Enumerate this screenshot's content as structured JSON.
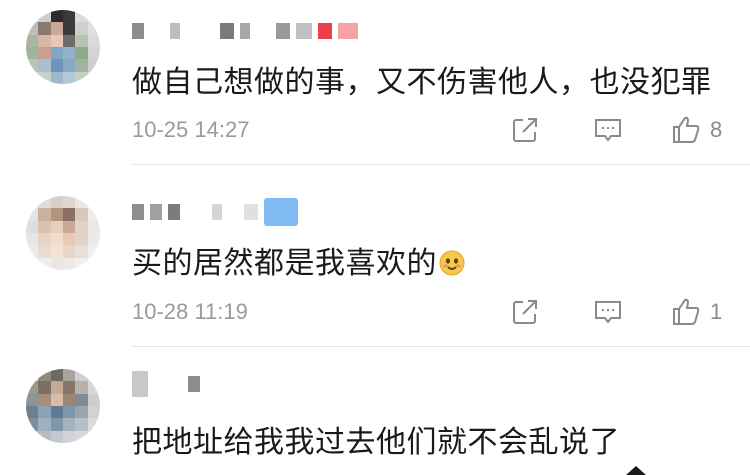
{
  "comments": [
    {
      "text": "做自己想做的事，又不伤害他人，也没犯罪",
      "timestamp": "10-25 14:27",
      "likes": "8",
      "emoji": ""
    },
    {
      "text": "买的居然都是我喜欢的",
      "timestamp": "10-28 11:19",
      "likes": "1",
      "emoji": "smiling-face-emoji"
    },
    {
      "text": "把地址给我我过去他们就不会乱说了",
      "timestamp": "",
      "likes": "",
      "emoji": ""
    }
  ],
  "icons": {
    "share": "share-icon",
    "reply": "comment-icon",
    "like": "thumbs-up-icon"
  },
  "colors": {
    "text": "#1a1a1a",
    "meta": "#9a9a9a",
    "divider": "#e6e6e6",
    "badge_red": "#e8414a",
    "badge_blue": "#6aaef0"
  }
}
